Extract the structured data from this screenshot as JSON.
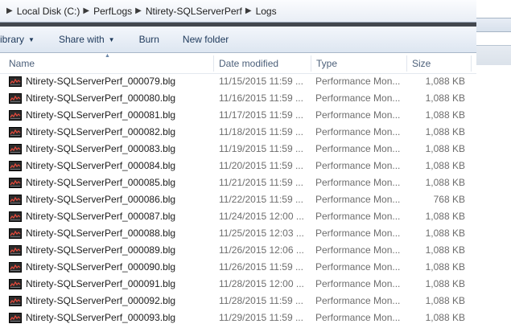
{
  "address": {
    "crumbs": [
      "Local Disk (C:)",
      "PerfLogs",
      "Ntirety-SQLServerPerf",
      "Logs"
    ]
  },
  "toolbar": {
    "library_label": "ibrary",
    "share_label": "Share with",
    "burn_label": "Burn",
    "new_folder_label": "New folder"
  },
  "columns": {
    "name": "Name",
    "date": "Date modified",
    "type": "Type",
    "size": "Size"
  },
  "files": [
    {
      "name": "Ntirety-SQLServerPerf_000079.blg",
      "date": "11/15/2015 11:59 ...",
      "type": "Performance Mon...",
      "size": "1,088 KB"
    },
    {
      "name": "Ntirety-SQLServerPerf_000080.blg",
      "date": "11/16/2015 11:59 ...",
      "type": "Performance Mon...",
      "size": "1,088 KB"
    },
    {
      "name": "Ntirety-SQLServerPerf_000081.blg",
      "date": "11/17/2015 11:59 ...",
      "type": "Performance Mon...",
      "size": "1,088 KB"
    },
    {
      "name": "Ntirety-SQLServerPerf_000082.blg",
      "date": "11/18/2015 11:59 ...",
      "type": "Performance Mon...",
      "size": "1,088 KB"
    },
    {
      "name": "Ntirety-SQLServerPerf_000083.blg",
      "date": "11/19/2015 11:59 ...",
      "type": "Performance Mon...",
      "size": "1,088 KB"
    },
    {
      "name": "Ntirety-SQLServerPerf_000084.blg",
      "date": "11/20/2015 11:59 ...",
      "type": "Performance Mon...",
      "size": "1,088 KB"
    },
    {
      "name": "Ntirety-SQLServerPerf_000085.blg",
      "date": "11/21/2015 11:59 ...",
      "type": "Performance Mon...",
      "size": "1,088 KB"
    },
    {
      "name": "Ntirety-SQLServerPerf_000086.blg",
      "date": "11/22/2015 11:59 ...",
      "type": "Performance Mon...",
      "size": "768 KB"
    },
    {
      "name": "Ntirety-SQLServerPerf_000087.blg",
      "date": "11/24/2015 12:00 ...",
      "type": "Performance Mon...",
      "size": "1,088 KB"
    },
    {
      "name": "Ntirety-SQLServerPerf_000088.blg",
      "date": "11/25/2015 12:03 ...",
      "type": "Performance Mon...",
      "size": "1,088 KB"
    },
    {
      "name": "Ntirety-SQLServerPerf_000089.blg",
      "date": "11/26/2015 12:06 ...",
      "type": "Performance Mon...",
      "size": "1,088 KB"
    },
    {
      "name": "Ntirety-SQLServerPerf_000090.blg",
      "date": "11/26/2015 11:59 ...",
      "type": "Performance Mon...",
      "size": "1,088 KB"
    },
    {
      "name": "Ntirety-SQLServerPerf_000091.blg",
      "date": "11/28/2015 12:00 ...",
      "type": "Performance Mon...",
      "size": "1,088 KB"
    },
    {
      "name": "Ntirety-SQLServerPerf_000092.blg",
      "date": "11/28/2015 11:59 ...",
      "type": "Performance Mon...",
      "size": "1,088 KB"
    },
    {
      "name": "Ntirety-SQLServerPerf_000093.blg",
      "date": "11/29/2015 11:59 ...",
      "type": "Performance Mon...",
      "size": "1,088 KB"
    }
  ],
  "icons": {
    "file_icon": "performance-log-icon",
    "crumb_separator": "chevron-right-icon",
    "dropdown": "chevron-down-icon",
    "sort": "sort-up-icon"
  }
}
